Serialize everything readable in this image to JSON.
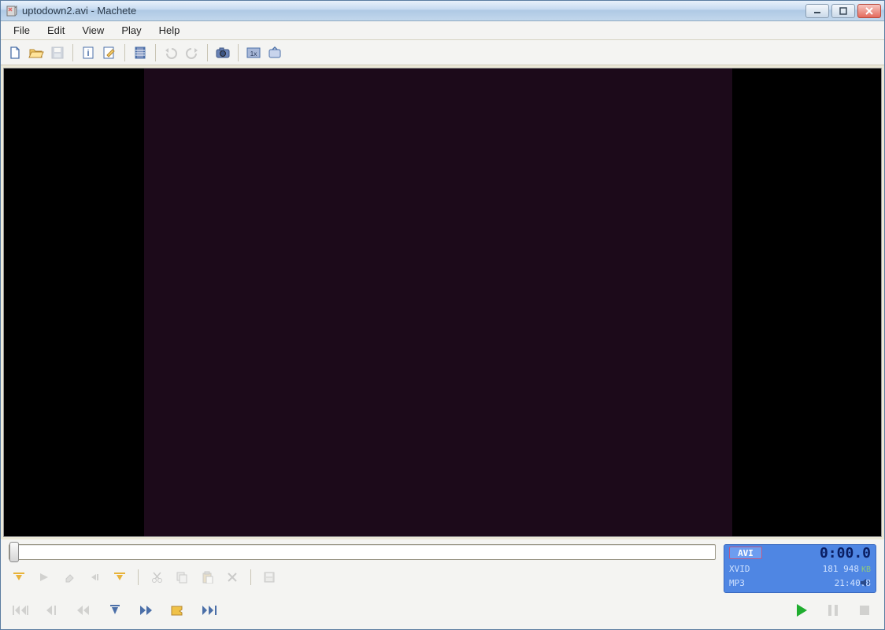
{
  "titlebar": {
    "title": "uptodown2.avi - Machete"
  },
  "menubar": {
    "items": [
      "File",
      "Edit",
      "View",
      "Play",
      "Help"
    ]
  },
  "toolbar": {
    "icons": [
      "new",
      "open",
      "save",
      "info",
      "edit-props",
      "film",
      "undo",
      "redo",
      "camera",
      "frame-1x",
      "tv"
    ]
  },
  "edit_toolbar": {
    "icons": [
      "mark-start",
      "play-selection",
      "erase",
      "mark-prev",
      "mark-end",
      "cut",
      "copy",
      "paste",
      "delete",
      "save-selection"
    ]
  },
  "playback": {
    "icons": [
      "first-frame",
      "prev-keyframe",
      "rewind",
      "goto-marker",
      "fast-forward",
      "bookmark",
      "last-frame",
      "play",
      "pause",
      "stop"
    ]
  },
  "info_panel": {
    "format": "AVI",
    "time": "0:00.0",
    "video_codec": "XVID",
    "filesize": "181 948",
    "filesize_unit": "KB",
    "audio_codec": "MP3",
    "duration": "21:40.8"
  },
  "colors": {
    "accent": "#4f86e3",
    "play_green": "#1fad2f",
    "icon_blue": "#4b6fa8",
    "icon_yellow": "#e8b33a"
  }
}
